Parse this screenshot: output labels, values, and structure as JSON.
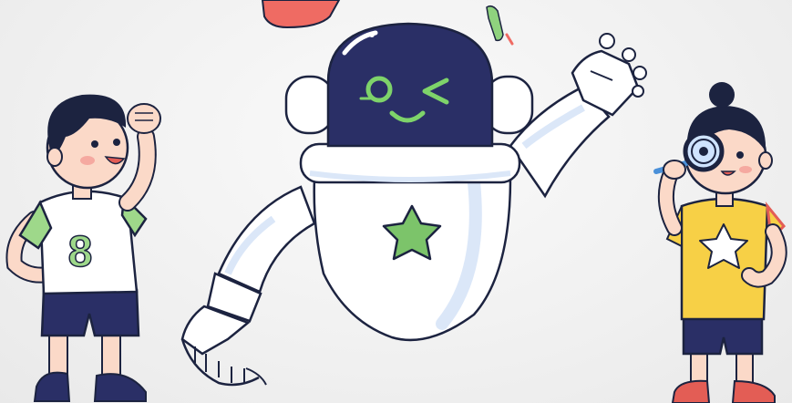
{
  "illustration": {
    "figures": [
      "boy",
      "robot",
      "girl"
    ],
    "boy_shirt_number": "8",
    "colors": {
      "background": "#efefef",
      "outline": "#1c2340",
      "robot_white": "#ffffff",
      "robot_shade": "#dbe7f8",
      "robot_face": "#2a2f66",
      "robot_eye": "#7ed36a",
      "star_green": "#7cc46a",
      "boy_sleeve": "#9ed88a",
      "boy_shorts": "#2a2f66",
      "girl_shirt": "#f7d046",
      "girl_shorts": "#2a2f66",
      "skin": "#fbd9c8",
      "hair": "#1c2340",
      "shoes": "#e35d55",
      "accent_red": "#ef6b63",
      "lens": "#cfe3ff"
    }
  }
}
